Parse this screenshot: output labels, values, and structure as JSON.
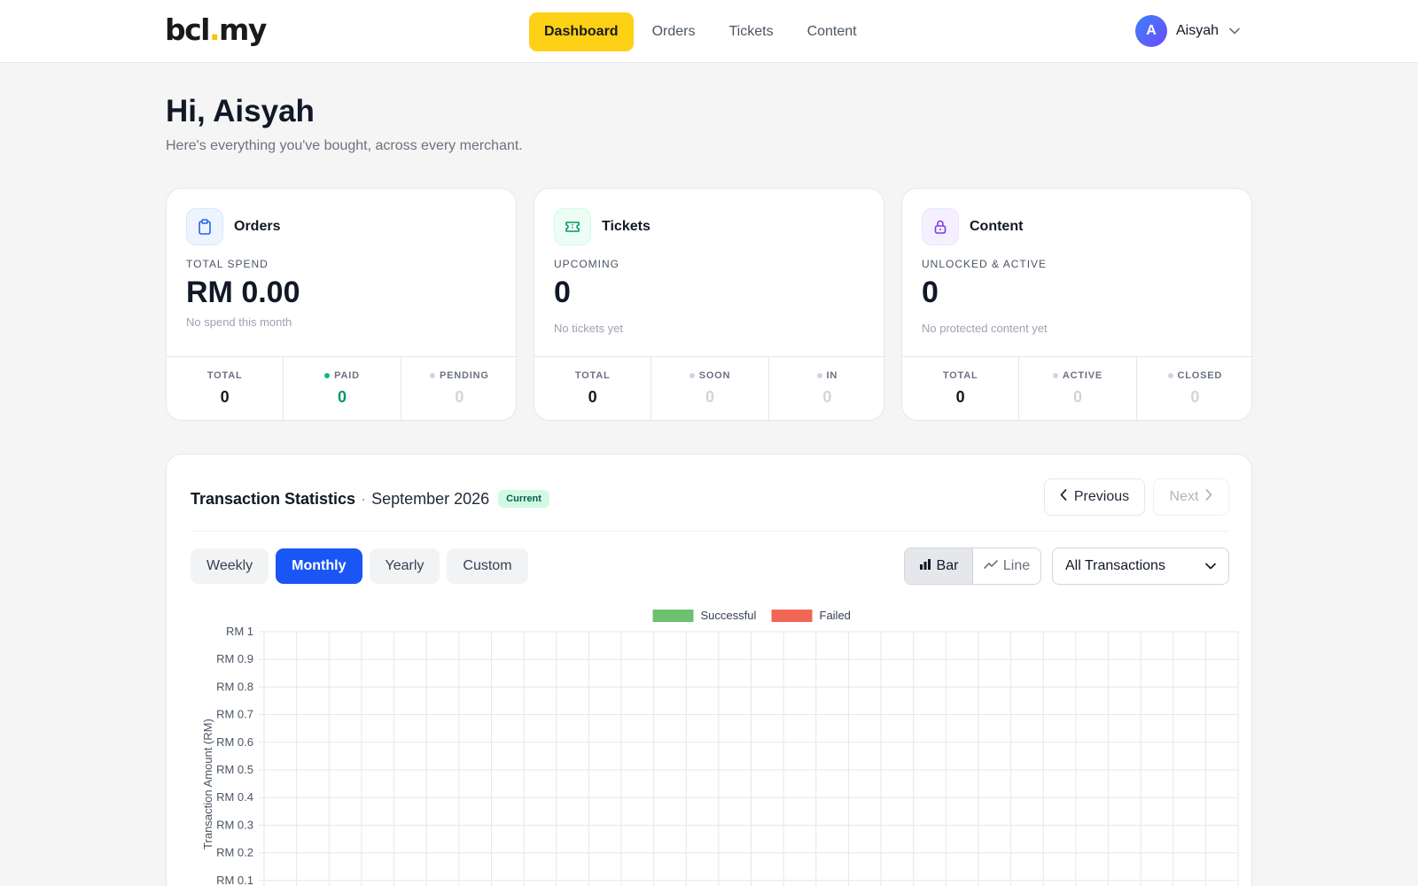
{
  "brand": {
    "logo_part1": "bcl",
    "logo_dot": ".",
    "logo_part2": "my"
  },
  "nav": [
    {
      "label": "Dashboard",
      "active": true
    },
    {
      "label": "Orders",
      "active": false
    },
    {
      "label": "Tickets",
      "active": false
    },
    {
      "label": "Content",
      "active": false
    }
  ],
  "user": {
    "initial": "A",
    "name": "Aisyah",
    "chevron_icon": "chevron-down-icon"
  },
  "greeting": {
    "title": "Hi, Aisyah",
    "subtitle": "Here's everything you've bought, across every merchant."
  },
  "cards": {
    "orders": {
      "icon": "clipboard-icon",
      "title": "Orders",
      "kicker": "TOTAL SPEND",
      "value": "RM 0.00",
      "hint": "No spend this month",
      "stats": [
        {
          "label": "TOTAL",
          "value": "0"
        },
        {
          "label": "PAID",
          "value": "0",
          "dot": "#10b981",
          "color": "#059669"
        },
        {
          "label": "PENDING",
          "value": "0",
          "dot": "#d1d5db",
          "color": "#d1d5db"
        }
      ]
    },
    "tickets": {
      "icon": "ticket-icon",
      "title": "Tickets",
      "kicker": "UPCOMING",
      "value": "0",
      "hint": "No tickets yet",
      "stats": [
        {
          "label": "TOTAL",
          "value": "0"
        },
        {
          "label": "SOON",
          "value": "0",
          "dot": "#d1d5db",
          "color": "#d1d5db"
        },
        {
          "label": "IN",
          "value": "0",
          "dot": "#d1d5db",
          "color": "#d1d5db"
        }
      ]
    },
    "content": {
      "icon": "lock-icon",
      "title": "Content",
      "kicker": "UNLOCKED & ACTIVE",
      "value": "0",
      "hint": "No protected content yet",
      "stats": [
        {
          "label": "TOTAL",
          "value": "0"
        },
        {
          "label": "ACTIVE",
          "value": "0",
          "dot": "#d1d5db",
          "color": "#d1d5db"
        },
        {
          "label": "CLOSED",
          "value": "0",
          "dot": "#d1d5db",
          "color": "#d1d5db"
        }
      ]
    }
  },
  "stats_panel": {
    "title": "Transaction Statistics",
    "separator": "·",
    "period": "September 2026",
    "badge": "Current",
    "prev_label": "Previous",
    "next_label": "Next",
    "ranges": [
      {
        "label": "Weekly",
        "active": false
      },
      {
        "label": "Monthly",
        "active": true
      },
      {
        "label": "Yearly",
        "active": false
      },
      {
        "label": "Custom",
        "active": false
      }
    ],
    "chart_types": [
      {
        "label": "Bar",
        "icon": "bar-chart-icon",
        "active": true
      },
      {
        "label": "Line",
        "icon": "line-chart-icon",
        "active": false
      }
    ],
    "filter": {
      "value": "All Transactions"
    }
  },
  "colors": {
    "accent_yellow": "#fcd116",
    "primary_blue": "#1a56f5",
    "successful": "#6cc070",
    "failed": "#f26657"
  },
  "chart_data": {
    "type": "bar",
    "ylabel": "Transaction Amount (RM)",
    "ylim": [
      0,
      1
    ],
    "y_ticks": [
      "RM 1",
      "RM 0.9",
      "RM 0.8",
      "RM 0.7",
      "RM 0.6",
      "RM 0.5",
      "RM 0.4",
      "RM 0.3",
      "RM 0.2",
      "RM 0.1"
    ],
    "series": [
      {
        "name": "Successful",
        "color": "#6cc070",
        "values": []
      },
      {
        "name": "Failed",
        "color": "#f26657",
        "values": []
      }
    ],
    "legend": "top-center",
    "grid": true
  }
}
